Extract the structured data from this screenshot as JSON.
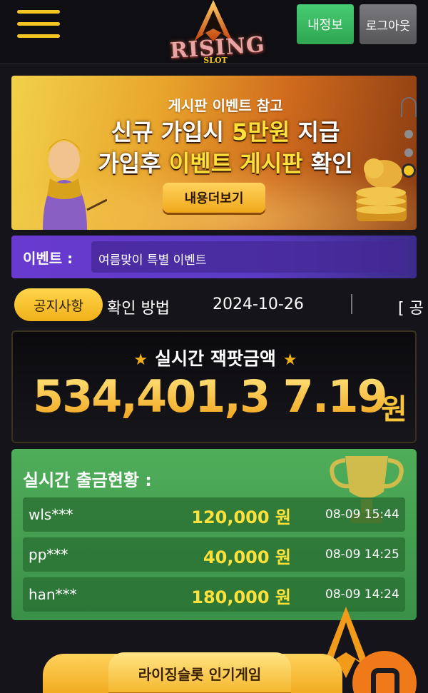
{
  "header": {
    "my_info_button": "내정보",
    "logout_button": "로그아웃",
    "logo_text": "RISING",
    "logo_sub": "SLOT"
  },
  "banner": {
    "small_title": "게시판 이벤트 참고",
    "line1_a": "신규 가입시 ",
    "line1_highlight": "5만원",
    "line1_b": " 지급",
    "line2_a": "가입후 ",
    "line2_highlight": "이벤트 게시판",
    "line2_b": " 확인",
    "more_button": "내용더보기"
  },
  "event": {
    "label": "이벤트 :",
    "text": "여름맞이 특별 이벤트"
  },
  "notice": {
    "pill": "공지사항",
    "title": "확인 방법",
    "date": "2024-10-26",
    "next": "[ 공"
  },
  "jackpot": {
    "title": "실시간 잭팟금액",
    "value": "534,401,3 7.19",
    "unit": "원"
  },
  "withdraw": {
    "title": "실시간 출금현황 :",
    "rows": [
      {
        "user": "wls***",
        "amount": "120,000 원",
        "time": "08-09 15:44"
      },
      {
        "user": "pp***",
        "amount": "40,000 원",
        "time": "08-09 14:25"
      },
      {
        "user": "han***",
        "amount": "180,000 원",
        "time": "08-09 14:24"
      }
    ]
  },
  "popular": {
    "title": "라이징슬롯 인기게임"
  },
  "colors": {
    "accent_yellow": "#f3c623",
    "green_button": "#3dbb63",
    "event_purple": "#5a3cc4",
    "withdraw_green": "#46a052"
  }
}
